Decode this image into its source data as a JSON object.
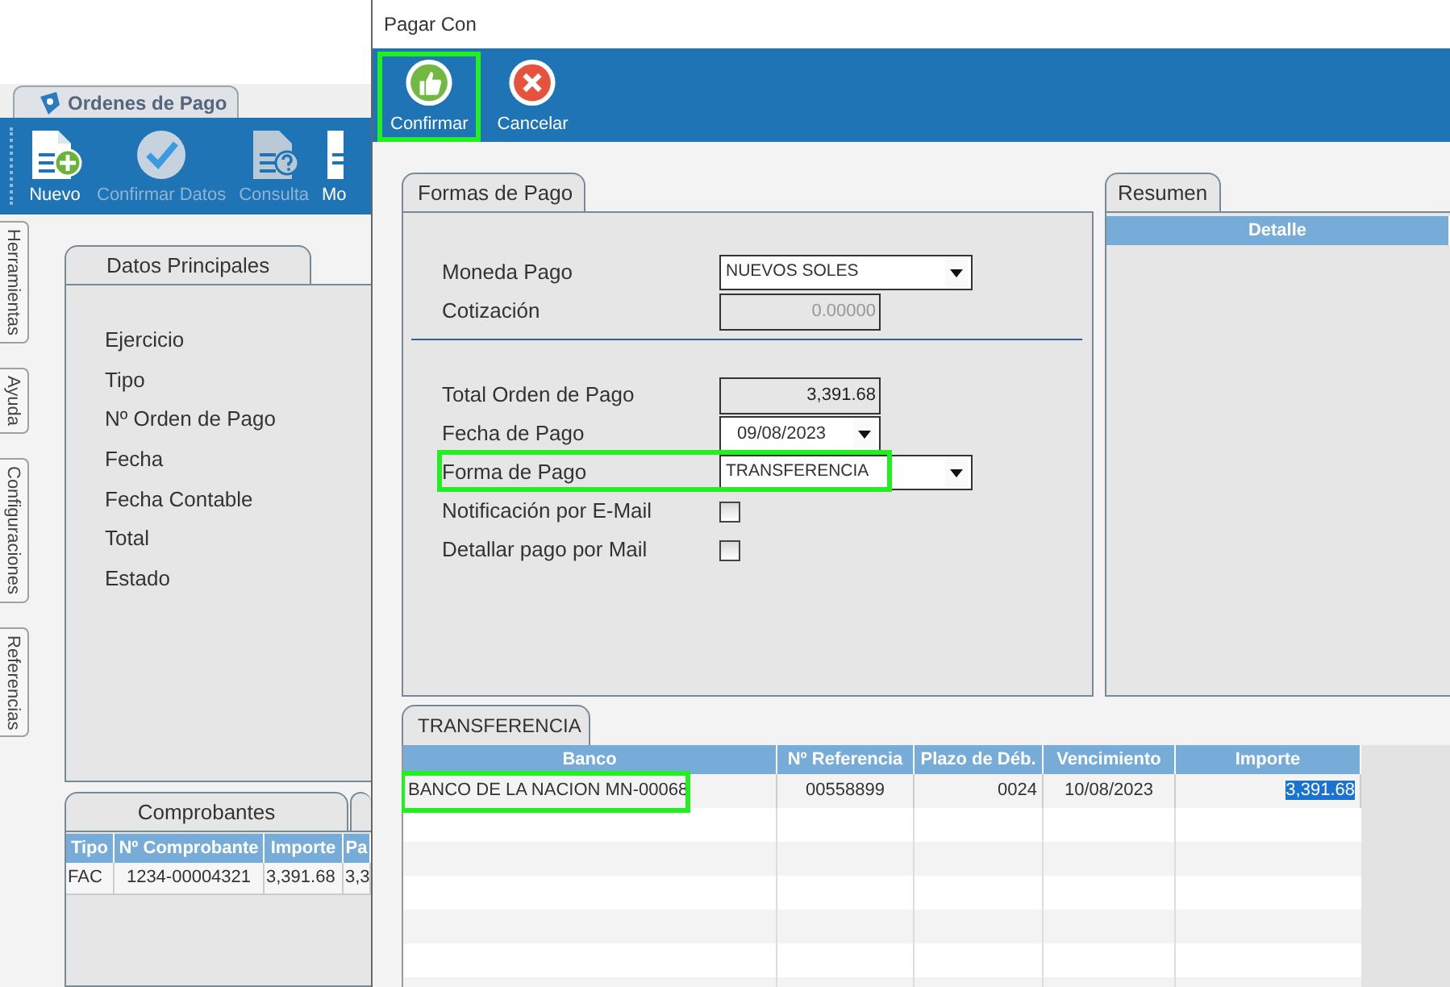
{
  "main_window": {
    "tab": "Ordenes de Pago",
    "toolbar": [
      {
        "label": "Nuevo",
        "kind": "new",
        "disabled": false
      },
      {
        "label": "Confirmar Datos",
        "kind": "confirm",
        "disabled": true
      },
      {
        "label": "Consulta",
        "kind": "query",
        "disabled": true
      },
      {
        "label": "Mo",
        "kind": "doc",
        "disabled": false
      }
    ],
    "side_tabs": [
      "Herramientas",
      "Ayuda",
      "Configuraciones",
      "Referencias"
    ],
    "main_tab": "Datos Principales",
    "fields": [
      "Ejercicio",
      "Tipo",
      "Nº Orden de Pago",
      "Fecha",
      "Fecha Contable",
      "Total",
      "Estado"
    ],
    "bottom_tab": "Comprobantes",
    "table": {
      "columns": [
        "Tipo",
        "Nº Comprobante",
        "Importe",
        "Pa"
      ],
      "rows": [
        [
          "FAC",
          "1234-00004321",
          "3,391.68",
          "3,3"
        ]
      ]
    }
  },
  "dialog": {
    "title": "Pagar Con",
    "toolbar": [
      {
        "label": "Confirmar",
        "kind": "confirm",
        "highlighted": true
      },
      {
        "label": "Cancelar",
        "kind": "cancel",
        "highlighted": false
      }
    ],
    "forms_tab": "Formas de Pago",
    "fields": [
      {
        "kind": "select",
        "label": "Moneda Pago",
        "value": "NUEVOS SOLES",
        "highlighted": false
      },
      {
        "kind": "number",
        "label": "Cotización",
        "value": "0.00000",
        "disabled": true
      },
      {
        "kind": "separator"
      },
      {
        "kind": "number",
        "label": "Total Orden de Pago",
        "value": "3,391.68",
        "disabled": false
      },
      {
        "kind": "date",
        "label": "Fecha de Pago",
        "value": "09/08/2023"
      },
      {
        "kind": "select",
        "label": "Forma de Pago",
        "value": "TRANSFERENCIA",
        "highlighted": true
      },
      {
        "kind": "checkbox",
        "label": "Notificación por E-Mail",
        "checked": false
      },
      {
        "kind": "checkbox",
        "label": "Detallar pago por Mail",
        "checked": false
      }
    ],
    "summary": {
      "tab": "Resumen",
      "columns": [
        "Detalle"
      ]
    },
    "transfer": {
      "tab": "TRANSFERENCIA",
      "columns": [
        "Banco",
        "Nº Referencia",
        "Plazo de Déb.",
        "Vencimiento",
        "Importe"
      ],
      "rows": [
        [
          {
            "text": "BANCO DE LA NACION MN-00068",
            "highlighted": true,
            "selected": false
          },
          {
            "text": "00558899",
            "highlighted": false,
            "selected": false
          },
          {
            "text": "0024",
            "highlighted": false,
            "selected": false
          },
          {
            "text": "10/08/2023",
            "highlighted": false,
            "selected": false
          },
          {
            "text": "3,391.68",
            "highlighted": false,
            "selected": true
          }
        ]
      ]
    }
  }
}
